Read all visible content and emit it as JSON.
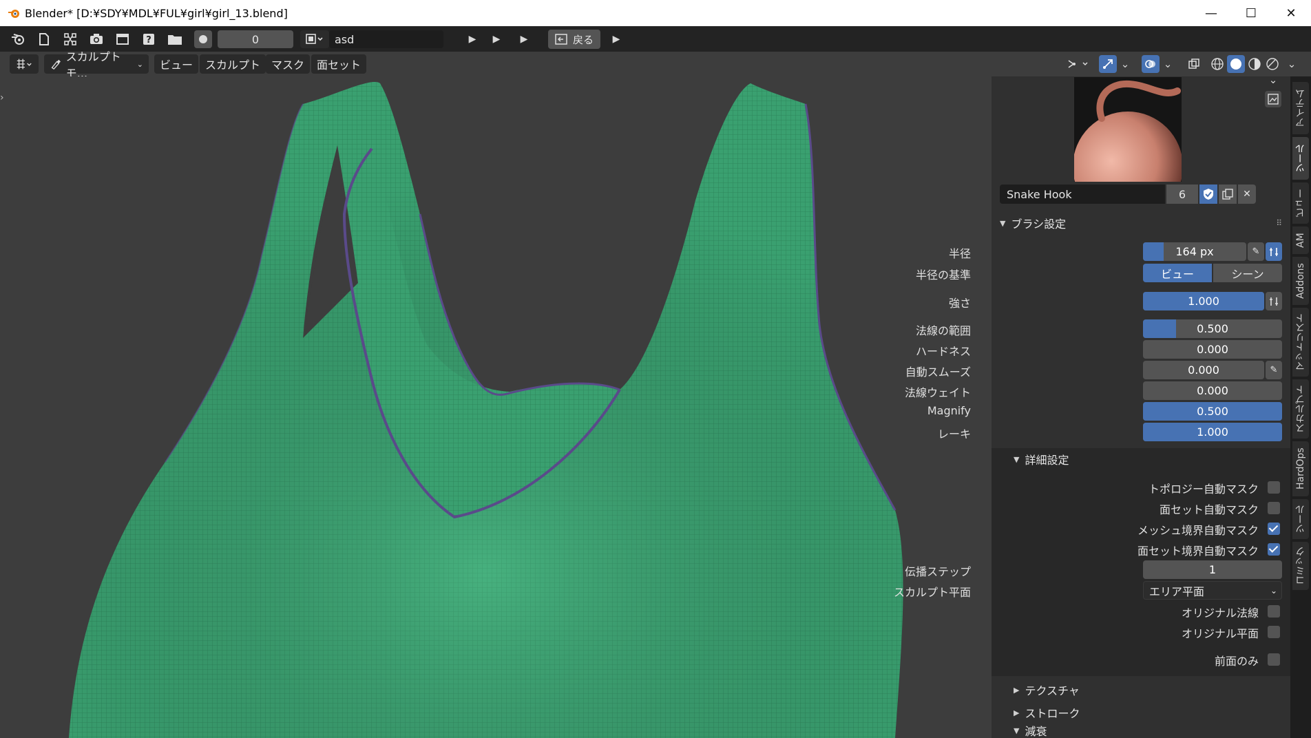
{
  "window": {
    "title": "Blender* [D:¥SDY¥MDL¥FUL¥girl¥girl_13.blend]",
    "minimize": "—",
    "maximize": "☐",
    "close": "✕"
  },
  "topbar": {
    "frame": "0",
    "scene": "asd",
    "back_label": "戻る"
  },
  "header": {
    "mode": "スカルプトモ...",
    "menus": [
      "ビュー",
      "スカルプト",
      "マスク",
      "面セット"
    ]
  },
  "brush": {
    "name": "Snake Hook",
    "users": "6"
  },
  "brush_settings": {
    "title": "ブラシ設定",
    "radius_label": "半径",
    "radius_value": "164 px",
    "radius_unit_label": "半径の基準",
    "radius_unit_options": [
      "ビュー",
      "シーン"
    ],
    "radius_unit_selected": "ビュー",
    "strength_label": "強さ",
    "strength_value": "1.000",
    "normal_radius_label": "法線の範囲",
    "normal_radius_value": "0.500",
    "hardness_label": "ハードネス",
    "hardness_value": "0.000",
    "autosmooth_label": "自動スムーズ",
    "autosmooth_value": "0.000",
    "normal_weight_label": "法線ウェイト",
    "normal_weight_value": "0.000",
    "magnify_label": "Magnify",
    "magnify_value": "0.500",
    "rake_label": "レーキ",
    "rake_value": "1.000",
    "fills": {
      "radius": 0.2,
      "strength": 1.0,
      "normal_radius": 0.25,
      "magnify": 1.0,
      "rake": 1.0
    }
  },
  "advanced": {
    "title": "詳細設定",
    "topology_automask": "トポロジー自動マスク",
    "topology_automask_checked": false,
    "faceset_automask": "面セット自動マスク",
    "faceset_automask_checked": false,
    "mesh_boundary_automask": "メッシュ境界自動マスク",
    "mesh_boundary_automask_checked": true,
    "faceset_boundary_automask": "面セット境界自動マスク",
    "faceset_boundary_automask_checked": true,
    "propagation_steps_label": "伝播ステップ",
    "propagation_steps_value": "1",
    "sculpt_plane_label": "スカルプト平面",
    "sculpt_plane_value": "エリア平面",
    "original_normal": "オリジナル法線",
    "original_normal_checked": false,
    "original_plane": "オリジナル平面",
    "original_plane_checked": false,
    "front_faces_only": "前面のみ",
    "front_faces_only_checked": false
  },
  "collapsed_sections": [
    "テクスチャ",
    "ストローク",
    "減衰"
  ],
  "side_tabs": [
    "アイテム",
    "ツール",
    "ビュー",
    "AM",
    "Addons",
    "マットリスト",
    "スカルプト",
    "HardOps",
    "ツール",
    "コミック"
  ],
  "colors": {
    "accent": "#4772b3",
    "mesh": "#3aa070",
    "mesh_border": "#5a4a8a"
  }
}
